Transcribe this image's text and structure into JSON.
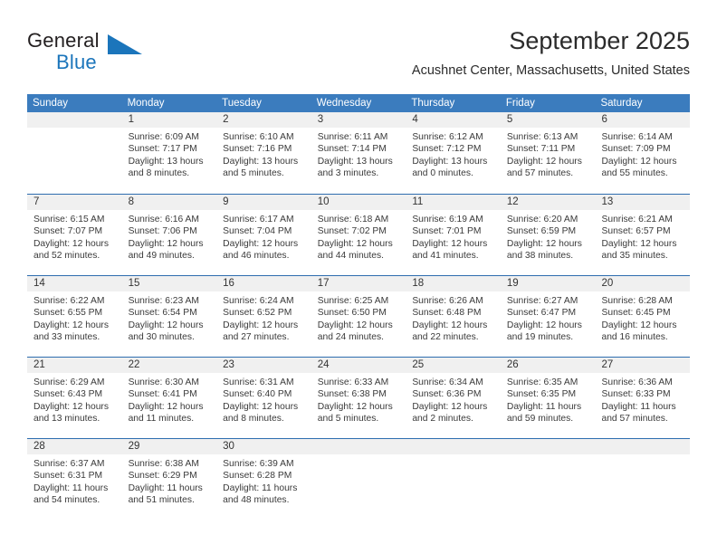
{
  "brand": {
    "name_part1": "General",
    "name_part2": "Blue",
    "flag_icon": "triangle-flag-icon"
  },
  "header": {
    "month_title": "September 2025",
    "location": "Acushnet Center, Massachusetts, United States"
  },
  "colors": {
    "header_blue": "#3b7cbe",
    "rule_blue": "#2e6daf",
    "brand_blue": "#1b75bb",
    "date_band": "#f0f0f0"
  },
  "calendar": {
    "day_names": [
      "Sunday",
      "Monday",
      "Tuesday",
      "Wednesday",
      "Thursday",
      "Friday",
      "Saturday"
    ],
    "weeks": [
      [
        {
          "day": "",
          "sunrise": "",
          "sunset": "",
          "daylight_line1": "",
          "daylight_line2": ""
        },
        {
          "day": "1",
          "sunrise": "Sunrise: 6:09 AM",
          "sunset": "Sunset: 7:17 PM",
          "daylight_line1": "Daylight: 13 hours",
          "daylight_line2": "and 8 minutes."
        },
        {
          "day": "2",
          "sunrise": "Sunrise: 6:10 AM",
          "sunset": "Sunset: 7:16 PM",
          "daylight_line1": "Daylight: 13 hours",
          "daylight_line2": "and 5 minutes."
        },
        {
          "day": "3",
          "sunrise": "Sunrise: 6:11 AM",
          "sunset": "Sunset: 7:14 PM",
          "daylight_line1": "Daylight: 13 hours",
          "daylight_line2": "and 3 minutes."
        },
        {
          "day": "4",
          "sunrise": "Sunrise: 6:12 AM",
          "sunset": "Sunset: 7:12 PM",
          "daylight_line1": "Daylight: 13 hours",
          "daylight_line2": "and 0 minutes."
        },
        {
          "day": "5",
          "sunrise": "Sunrise: 6:13 AM",
          "sunset": "Sunset: 7:11 PM",
          "daylight_line1": "Daylight: 12 hours",
          "daylight_line2": "and 57 minutes."
        },
        {
          "day": "6",
          "sunrise": "Sunrise: 6:14 AM",
          "sunset": "Sunset: 7:09 PM",
          "daylight_line1": "Daylight: 12 hours",
          "daylight_line2": "and 55 minutes."
        }
      ],
      [
        {
          "day": "7",
          "sunrise": "Sunrise: 6:15 AM",
          "sunset": "Sunset: 7:07 PM",
          "daylight_line1": "Daylight: 12 hours",
          "daylight_line2": "and 52 minutes."
        },
        {
          "day": "8",
          "sunrise": "Sunrise: 6:16 AM",
          "sunset": "Sunset: 7:06 PM",
          "daylight_line1": "Daylight: 12 hours",
          "daylight_line2": "and 49 minutes."
        },
        {
          "day": "9",
          "sunrise": "Sunrise: 6:17 AM",
          "sunset": "Sunset: 7:04 PM",
          "daylight_line1": "Daylight: 12 hours",
          "daylight_line2": "and 46 minutes."
        },
        {
          "day": "10",
          "sunrise": "Sunrise: 6:18 AM",
          "sunset": "Sunset: 7:02 PM",
          "daylight_line1": "Daylight: 12 hours",
          "daylight_line2": "and 44 minutes."
        },
        {
          "day": "11",
          "sunrise": "Sunrise: 6:19 AM",
          "sunset": "Sunset: 7:01 PM",
          "daylight_line1": "Daylight: 12 hours",
          "daylight_line2": "and 41 minutes."
        },
        {
          "day": "12",
          "sunrise": "Sunrise: 6:20 AM",
          "sunset": "Sunset: 6:59 PM",
          "daylight_line1": "Daylight: 12 hours",
          "daylight_line2": "and 38 minutes."
        },
        {
          "day": "13",
          "sunrise": "Sunrise: 6:21 AM",
          "sunset": "Sunset: 6:57 PM",
          "daylight_line1": "Daylight: 12 hours",
          "daylight_line2": "and 35 minutes."
        }
      ],
      [
        {
          "day": "14",
          "sunrise": "Sunrise: 6:22 AM",
          "sunset": "Sunset: 6:55 PM",
          "daylight_line1": "Daylight: 12 hours",
          "daylight_line2": "and 33 minutes."
        },
        {
          "day": "15",
          "sunrise": "Sunrise: 6:23 AM",
          "sunset": "Sunset: 6:54 PM",
          "daylight_line1": "Daylight: 12 hours",
          "daylight_line2": "and 30 minutes."
        },
        {
          "day": "16",
          "sunrise": "Sunrise: 6:24 AM",
          "sunset": "Sunset: 6:52 PM",
          "daylight_line1": "Daylight: 12 hours",
          "daylight_line2": "and 27 minutes."
        },
        {
          "day": "17",
          "sunrise": "Sunrise: 6:25 AM",
          "sunset": "Sunset: 6:50 PM",
          "daylight_line1": "Daylight: 12 hours",
          "daylight_line2": "and 24 minutes."
        },
        {
          "day": "18",
          "sunrise": "Sunrise: 6:26 AM",
          "sunset": "Sunset: 6:48 PM",
          "daylight_line1": "Daylight: 12 hours",
          "daylight_line2": "and 22 minutes."
        },
        {
          "day": "19",
          "sunrise": "Sunrise: 6:27 AM",
          "sunset": "Sunset: 6:47 PM",
          "daylight_line1": "Daylight: 12 hours",
          "daylight_line2": "and 19 minutes."
        },
        {
          "day": "20",
          "sunrise": "Sunrise: 6:28 AM",
          "sunset": "Sunset: 6:45 PM",
          "daylight_line1": "Daylight: 12 hours",
          "daylight_line2": "and 16 minutes."
        }
      ],
      [
        {
          "day": "21",
          "sunrise": "Sunrise: 6:29 AM",
          "sunset": "Sunset: 6:43 PM",
          "daylight_line1": "Daylight: 12 hours",
          "daylight_line2": "and 13 minutes."
        },
        {
          "day": "22",
          "sunrise": "Sunrise: 6:30 AM",
          "sunset": "Sunset: 6:41 PM",
          "daylight_line1": "Daylight: 12 hours",
          "daylight_line2": "and 11 minutes."
        },
        {
          "day": "23",
          "sunrise": "Sunrise: 6:31 AM",
          "sunset": "Sunset: 6:40 PM",
          "daylight_line1": "Daylight: 12 hours",
          "daylight_line2": "and 8 minutes."
        },
        {
          "day": "24",
          "sunrise": "Sunrise: 6:33 AM",
          "sunset": "Sunset: 6:38 PM",
          "daylight_line1": "Daylight: 12 hours",
          "daylight_line2": "and 5 minutes."
        },
        {
          "day": "25",
          "sunrise": "Sunrise: 6:34 AM",
          "sunset": "Sunset: 6:36 PM",
          "daylight_line1": "Daylight: 12 hours",
          "daylight_line2": "and 2 minutes."
        },
        {
          "day": "26",
          "sunrise": "Sunrise: 6:35 AM",
          "sunset": "Sunset: 6:35 PM",
          "daylight_line1": "Daylight: 11 hours",
          "daylight_line2": "and 59 minutes."
        },
        {
          "day": "27",
          "sunrise": "Sunrise: 6:36 AM",
          "sunset": "Sunset: 6:33 PM",
          "daylight_line1": "Daylight: 11 hours",
          "daylight_line2": "and 57 minutes."
        }
      ],
      [
        {
          "day": "28",
          "sunrise": "Sunrise: 6:37 AM",
          "sunset": "Sunset: 6:31 PM",
          "daylight_line1": "Daylight: 11 hours",
          "daylight_line2": "and 54 minutes."
        },
        {
          "day": "29",
          "sunrise": "Sunrise: 6:38 AM",
          "sunset": "Sunset: 6:29 PM",
          "daylight_line1": "Daylight: 11 hours",
          "daylight_line2": "and 51 minutes."
        },
        {
          "day": "30",
          "sunrise": "Sunrise: 6:39 AM",
          "sunset": "Sunset: 6:28 PM",
          "daylight_line1": "Daylight: 11 hours",
          "daylight_line2": "and 48 minutes."
        },
        {
          "day": "",
          "sunrise": "",
          "sunset": "",
          "daylight_line1": "",
          "daylight_line2": ""
        },
        {
          "day": "",
          "sunrise": "",
          "sunset": "",
          "daylight_line1": "",
          "daylight_line2": ""
        },
        {
          "day": "",
          "sunrise": "",
          "sunset": "",
          "daylight_line1": "",
          "daylight_line2": ""
        },
        {
          "day": "",
          "sunrise": "",
          "sunset": "",
          "daylight_line1": "",
          "daylight_line2": ""
        }
      ]
    ]
  }
}
